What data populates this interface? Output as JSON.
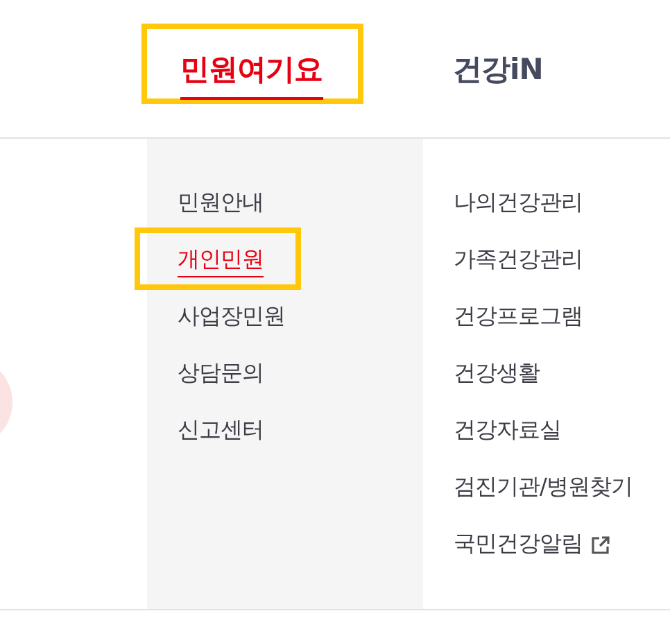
{
  "top_menu": [
    {
      "label": "민원여기요",
      "selected": true,
      "highlighted": true
    },
    {
      "label": "건강iN",
      "selected": false,
      "highlighted": false
    }
  ],
  "submenu_columns": [
    {
      "items": [
        {
          "label": "민원안내",
          "selected": false,
          "highlighted": false,
          "external": false
        },
        {
          "label": "개인민원",
          "selected": true,
          "highlighted": true,
          "external": false
        },
        {
          "label": "사업장민원",
          "selected": false,
          "highlighted": false,
          "external": false
        },
        {
          "label": "상담문의",
          "selected": false,
          "highlighted": false,
          "external": false
        },
        {
          "label": "신고센터",
          "selected": false,
          "highlighted": false,
          "external": false
        }
      ]
    },
    {
      "items": [
        {
          "label": "나의건강관리",
          "selected": false,
          "highlighted": false,
          "external": false
        },
        {
          "label": "가족건강관리",
          "selected": false,
          "highlighted": false,
          "external": false
        },
        {
          "label": "건강프로그램",
          "selected": false,
          "highlighted": false,
          "external": false
        },
        {
          "label": "건강생활",
          "selected": false,
          "highlighted": false,
          "external": false
        },
        {
          "label": "건강자료실",
          "selected": false,
          "highlighted": false,
          "external": false
        },
        {
          "label": "검진기관/병원찾기",
          "selected": false,
          "highlighted": false,
          "external": false
        },
        {
          "label": "국민건강알림",
          "selected": false,
          "highlighted": false,
          "external": true
        }
      ]
    }
  ]
}
